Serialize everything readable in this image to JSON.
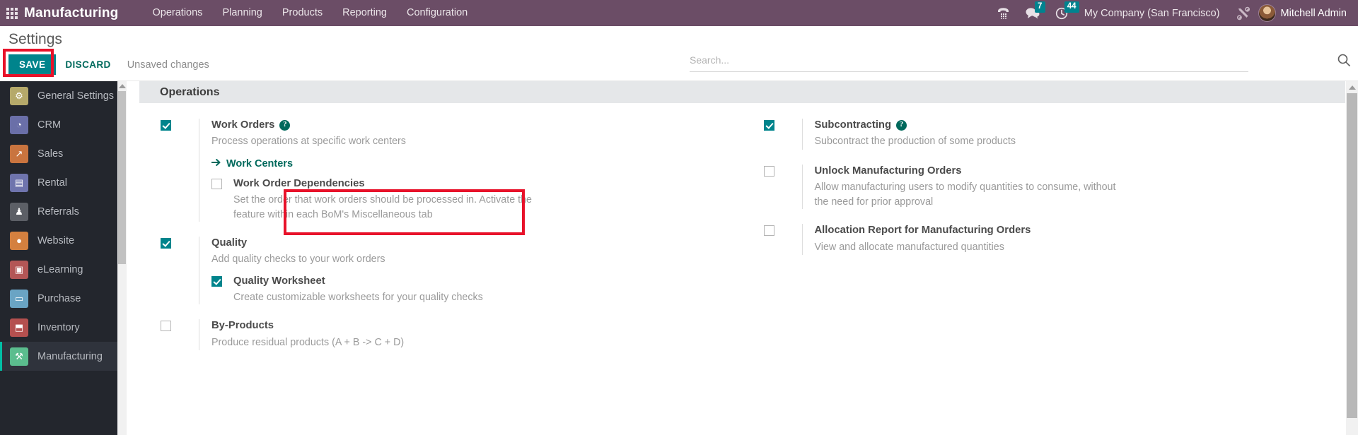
{
  "navbar": {
    "apps_icon": "apps-grid-icon",
    "brand": "Manufacturing",
    "menu": [
      {
        "label": "Operations"
      },
      {
        "label": "Planning"
      },
      {
        "label": "Products"
      },
      {
        "label": "Reporting"
      },
      {
        "label": "Configuration"
      }
    ],
    "right": {
      "phone_icon": "phone-icon",
      "messages_icon": "chat-bubble-icon",
      "messages_count": "7",
      "activities_icon": "clock-icon",
      "activities_count": "44",
      "company": "My Company (San Francisco)",
      "debug_icon": "tools-icon",
      "avatar": "user-avatar",
      "username": "Mitchell Admin"
    }
  },
  "control_panel": {
    "title": "Settings",
    "save_label": "SAVE",
    "discard_label": "DISCARD",
    "unsaved_text": "Unsaved changes",
    "search_placeholder": "Search...",
    "search_value": "",
    "search_icon": "magnifier-icon"
  },
  "sidebar": {
    "items": [
      {
        "label": "General Settings",
        "icon": "gear-icon",
        "color": "#b5a96a",
        "glyph": "⚙",
        "active": false
      },
      {
        "label": "CRM",
        "icon": "crm-handshake-icon",
        "color": "#6a6fa8",
        "glyph": "◔",
        "active": false
      },
      {
        "label": "Sales",
        "icon": "sales-chart-icon",
        "color": "#c9743f",
        "glyph": "↗",
        "active": false
      },
      {
        "label": "Rental",
        "icon": "rental-card-icon",
        "color": "#6f74ad",
        "glyph": "▤",
        "active": false
      },
      {
        "label": "Referrals",
        "icon": "referrals-person-icon",
        "color": "#5c5f66",
        "glyph": "♟",
        "active": false
      },
      {
        "label": "Website",
        "icon": "website-globe-icon",
        "color": "#d4803f",
        "glyph": "●",
        "active": false
      },
      {
        "label": "eLearning",
        "icon": "elearning-board-icon",
        "color": "#b35656",
        "glyph": "▣",
        "active": false
      },
      {
        "label": "Purchase",
        "icon": "purchase-card-icon",
        "color": "#6aa4c4",
        "glyph": "▭",
        "active": false
      },
      {
        "label": "Inventory",
        "icon": "inventory-box-icon",
        "color": "#b4504f",
        "glyph": "⬒",
        "active": false
      },
      {
        "label": "Manufacturing",
        "icon": "manufacturing-icon",
        "color": "#5bbd8e",
        "glyph": "⚒",
        "active": true
      }
    ]
  },
  "settings": {
    "section_title": "Operations",
    "left_column": [
      {
        "name": "work-orders",
        "label": "Work Orders",
        "checked": true,
        "has_help": true,
        "description": "Process operations at specific work centers",
        "link": {
          "label": "Work Centers",
          "icon": "arrow-right-icon"
        },
        "sub": [
          {
            "name": "work-order-dependencies",
            "label": "Work Order Dependencies",
            "checked": false,
            "description": "Set the order that work orders should be processed in. Activate the feature within each BoM's Miscellaneous tab"
          }
        ]
      },
      {
        "name": "quality",
        "label": "Quality",
        "checked": true,
        "has_help": false,
        "description": "Add quality checks to your work orders",
        "sub": [
          {
            "name": "quality-worksheet",
            "label": "Quality Worksheet",
            "checked": true,
            "description": "Create customizable worksheets for your quality checks"
          }
        ]
      },
      {
        "name": "by-products",
        "label": "By-Products",
        "checked": false,
        "has_help": false,
        "description": "Produce residual products (A + B -> C + D)"
      }
    ],
    "right_column": [
      {
        "name": "subcontracting",
        "label": "Subcontracting",
        "checked": true,
        "has_help": true,
        "description": "Subcontract the production of some products"
      },
      {
        "name": "unlock-manufacturing-orders",
        "label": "Unlock Manufacturing Orders",
        "checked": false,
        "has_help": false,
        "description": "Allow manufacturing users to modify quantities to consume, without the need for prior approval"
      },
      {
        "name": "allocation-report",
        "label": "Allocation Report for Manufacturing Orders",
        "checked": false,
        "has_help": false,
        "description": "View and allocate manufactured quantities"
      }
    ]
  },
  "annotations": {
    "accent_red": "#e8122a",
    "accent_teal": "#00848c",
    "navbar_purple": "#6b4d66",
    "sidebar_dark": "#23262d"
  }
}
